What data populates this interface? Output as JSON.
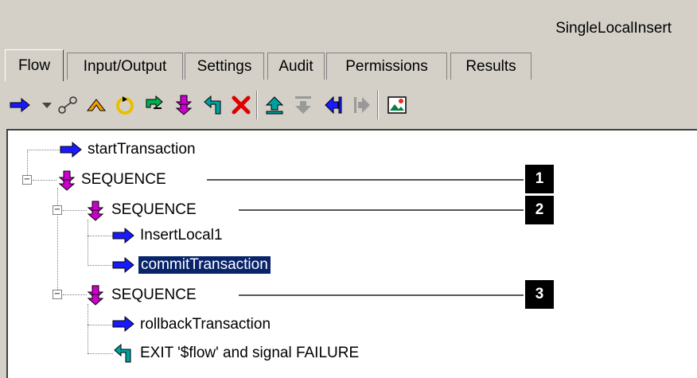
{
  "window": {
    "title": "SingleLocalInsert"
  },
  "tabs": [
    {
      "label": "Flow",
      "active": true
    },
    {
      "label": "Input/Output"
    },
    {
      "label": "Settings"
    },
    {
      "label": "Audit"
    },
    {
      "label": "Permissions"
    },
    {
      "label": "Results"
    }
  ],
  "toolbar": {
    "buttons": [
      "invoke-icon",
      "dropdown-icon",
      "branch-icon",
      "loop-icon",
      "repeat-icon",
      "map-icon",
      "sequence-icon",
      "exit-icon",
      "delete-icon",
      "move-up-icon",
      "move-down-icon",
      "shift-left-icon",
      "shift-right-icon",
      "image-icon"
    ]
  },
  "tree": {
    "nodes": [
      {
        "label": "startTransaction",
        "type": "invoke"
      },
      {
        "label": "SEQUENCE",
        "type": "sequence",
        "callout": "1"
      },
      {
        "label": "SEQUENCE",
        "type": "sequence",
        "callout": "2"
      },
      {
        "label": "InsertLocal1",
        "type": "invoke"
      },
      {
        "label": "commitTransaction",
        "type": "invoke",
        "selected": true
      },
      {
        "label": "SEQUENCE",
        "type": "sequence",
        "callout": "3"
      },
      {
        "label": "rollbackTransaction",
        "type": "invoke"
      },
      {
        "label": "EXIT '$flow' and signal FAILURE",
        "type": "exit"
      }
    ]
  },
  "colors": {
    "invoke": "#1a1aff",
    "sequence": "#cc00cc",
    "exit": "#008080",
    "selection": "#0a246a"
  }
}
